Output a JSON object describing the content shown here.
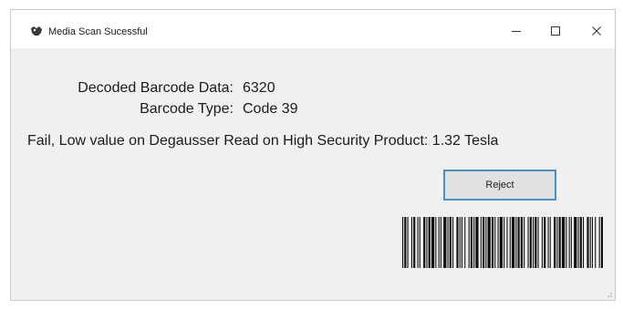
{
  "window": {
    "title": "Media Scan Sucessful",
    "controls": [
      "minimize-icon",
      "maximize-icon",
      "close-icon"
    ]
  },
  "decoded_label": "Decoded Barcode Data:",
  "decoded_value": "6320",
  "type_label": "Barcode Type:",
  "type_value": "Code 39",
  "status_message": "Fail, Low value on Degausser Read on High Security Product: 1.32 Tesla",
  "reject_label": "Reject",
  "barcode": {
    "encoded": "6320",
    "symbology": "Code 39"
  },
  "colors": {
    "button_border": "#4a90c8",
    "window_bg": "#f0f0f0"
  }
}
